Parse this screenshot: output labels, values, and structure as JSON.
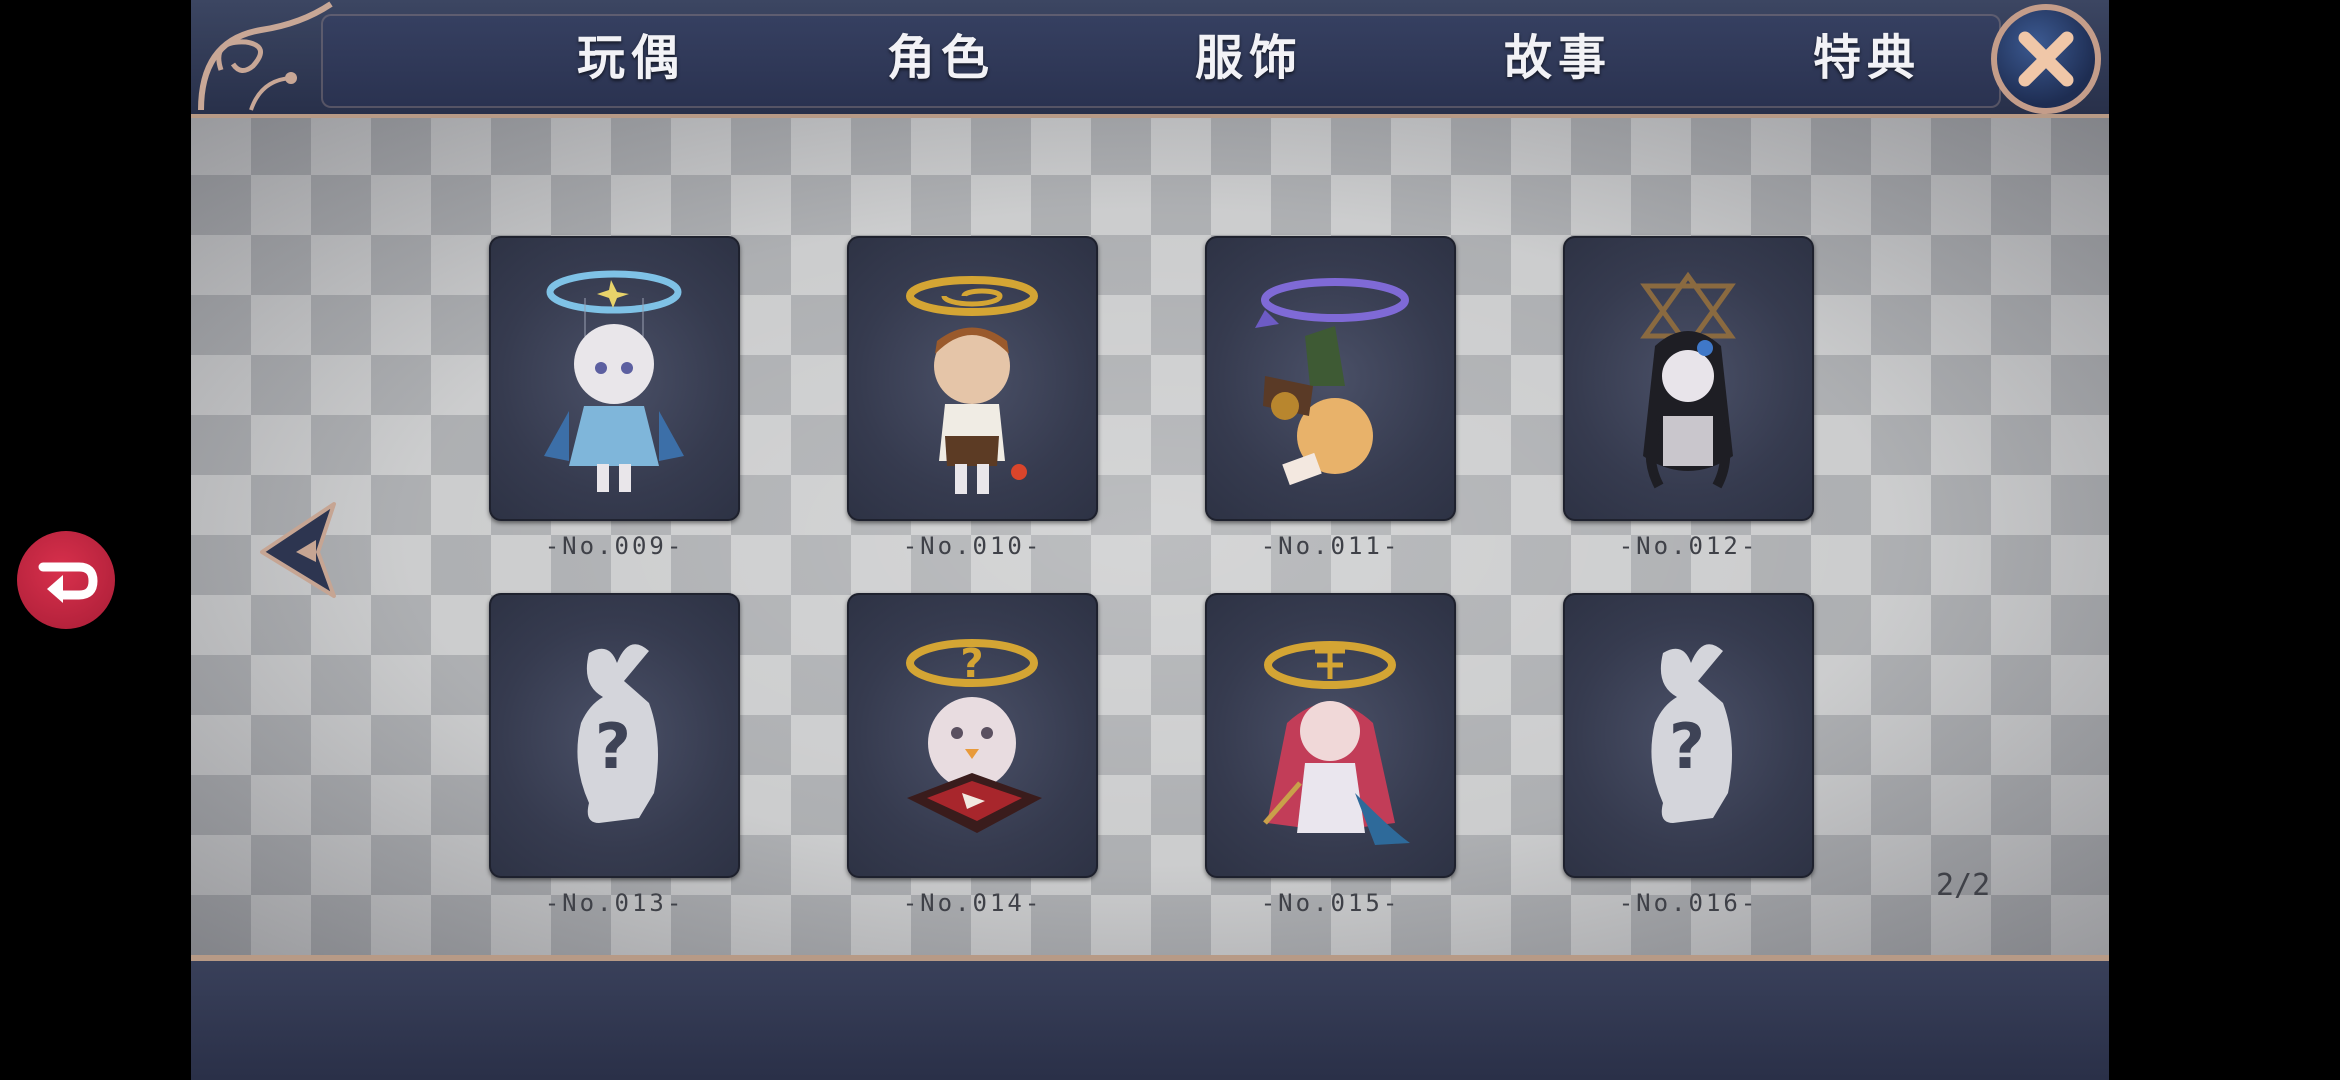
{
  "tabs": [
    {
      "label": "玩偶"
    },
    {
      "label": "角色"
    },
    {
      "label": "服饰"
    },
    {
      "label": "故事"
    },
    {
      "label": "特典"
    }
  ],
  "cards": [
    {
      "label": "-No.009-",
      "figure": "white-haired-doll-blue-halo",
      "locked": false
    },
    {
      "label": "-No.010-",
      "figure": "brown-haired-doll-gold-spiral",
      "locked": false
    },
    {
      "label": "-No.011-",
      "figure": "upside-down-doll-purple-arrow",
      "locked": false
    },
    {
      "label": "-No.012-",
      "figure": "black-haired-doll-hexagram",
      "locked": false
    },
    {
      "label": "-No.013-",
      "figure": "locked-silhouette",
      "locked": true
    },
    {
      "label": "-No.014-",
      "figure": "egg-doll-gold-question",
      "locked": false
    },
    {
      "label": "-No.015-",
      "figure": "red-haired-doll-gold-symbol",
      "locked": false
    },
    {
      "label": "-No.016-",
      "figure": "locked-silhouette",
      "locked": true
    }
  ],
  "pagination": {
    "text": "2/2"
  },
  "icons": {
    "close": "close-icon",
    "prev": "left-arrow-icon",
    "float": "floating-assistant-icon"
  },
  "colors": {
    "bar": "#2b3350",
    "card": "#363b4f",
    "accent": "#b79a86",
    "float": "#c4243f"
  }
}
